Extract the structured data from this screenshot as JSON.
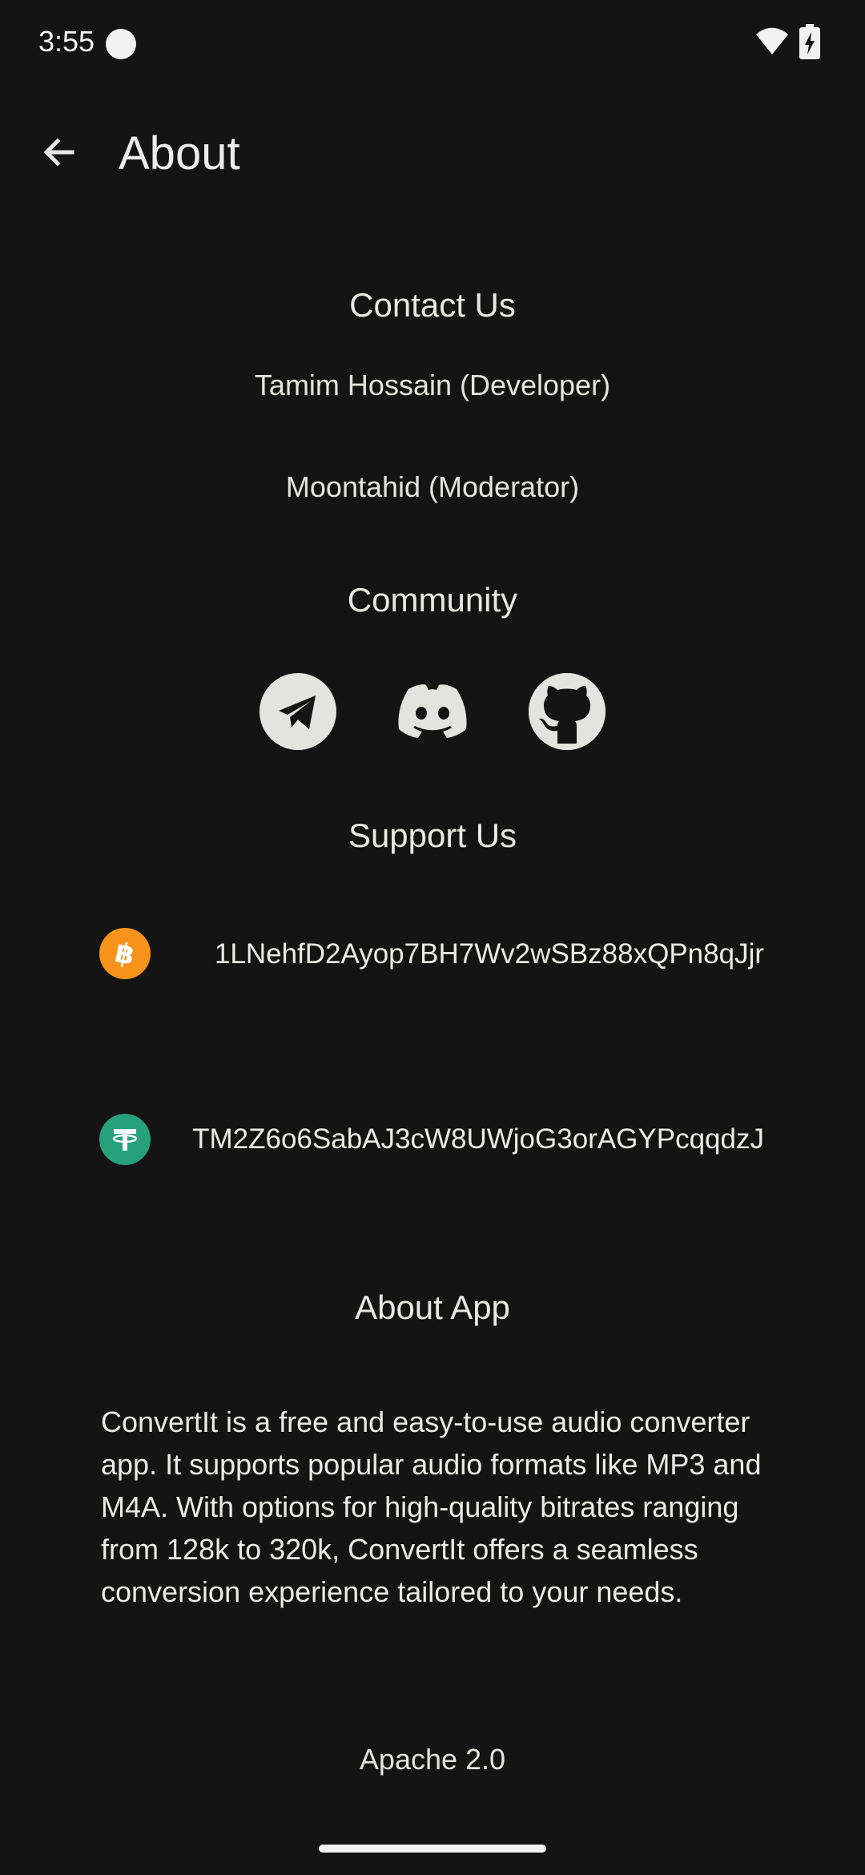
{
  "status_bar": {
    "time": "3:55",
    "icons": [
      "record-dot-icon",
      "wifi-icon",
      "battery-charging-icon"
    ]
  },
  "app_bar": {
    "back_icon": "arrow-left-icon",
    "title": "About"
  },
  "contact": {
    "title": "Contact Us",
    "people": [
      "Tamim Hossain (Developer)",
      "Moontahid (Moderator)"
    ]
  },
  "community": {
    "title": "Community",
    "links": [
      "telegram-icon",
      "discord-icon",
      "github-icon"
    ]
  },
  "support": {
    "title": "Support Us",
    "wallets": [
      {
        "icon": "bitcoin-icon",
        "color": "#f7931a",
        "address": "1LNehfD2Ayop7BH7Wv2wSBz88xQPn8qJjr"
      },
      {
        "icon": "tether-icon",
        "color": "#26a17b",
        "address": "TM2Z6o6SabAJ3cW8UWjoG3orAGYPcqqdzJ"
      }
    ]
  },
  "about_app": {
    "title": "About App",
    "description": "ConvertIt is a free and easy-to-use audio converter app. It supports popular audio formats like MP3 and M4A. With options for high-quality bitrates ranging from 128k to 320k, ConvertIt offers a seamless conversion experience tailored to your needs.",
    "license": "Apache 2.0"
  },
  "colors": {
    "background": "#141414",
    "text": "#e6e6e3"
  }
}
